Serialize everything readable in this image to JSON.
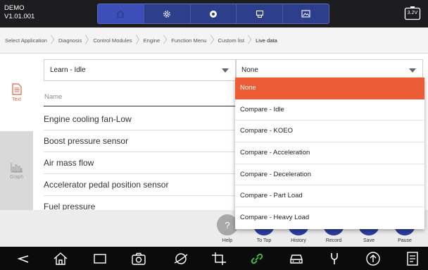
{
  "app": {
    "name_line1": "DEMO",
    "name_line2": "V1.01.001"
  },
  "topnav": {
    "items": [
      "home-icon",
      "gear-icon",
      "record-icon",
      "printer-icon",
      "image-icon"
    ],
    "active_index": 0
  },
  "battery": {
    "voltage": "3.2V"
  },
  "breadcrumb": [
    "Select Application",
    "Diagnosis",
    "Control Modules",
    "Engine",
    "Function Menu",
    "Custom list",
    "Live data"
  ],
  "sidetabs": {
    "text": "Text",
    "graph": "Graph"
  },
  "main": {
    "mode_select": "Learn - Idle",
    "compare_select": "None",
    "column_header": "Name",
    "rows": [
      "Engine cooling fan-Low",
      "Boost pressure sensor",
      "Air mass flow",
      "Accelerator pedal position sensor",
      "Fuel pressure"
    ]
  },
  "dropdown": {
    "options": [
      "None",
      "Compare - Idle",
      "Compare - KOEO",
      "Compare - Acceleration",
      "Compare - Deceleration",
      "Compare - Part Load",
      "Compare - Heavy Load"
    ],
    "selected": "None"
  },
  "actions": {
    "help": "Help",
    "help_glyph": "?",
    "to_top": "To Top",
    "history": "History",
    "record": "Record",
    "save": "Save",
    "pause": "Pause"
  },
  "colors": {
    "accent": "#ec5d36",
    "nav_blue": "#2d3e8c",
    "topbar": "#1d1d1f",
    "active_green": "#3ec63e"
  },
  "system_nav": [
    "back-icon",
    "home-icon",
    "recents-icon",
    "camera-icon",
    "browser-icon",
    "crop-icon",
    "link-icon",
    "car-icon",
    "wrench-icon",
    "upload-icon",
    "report-icon"
  ]
}
